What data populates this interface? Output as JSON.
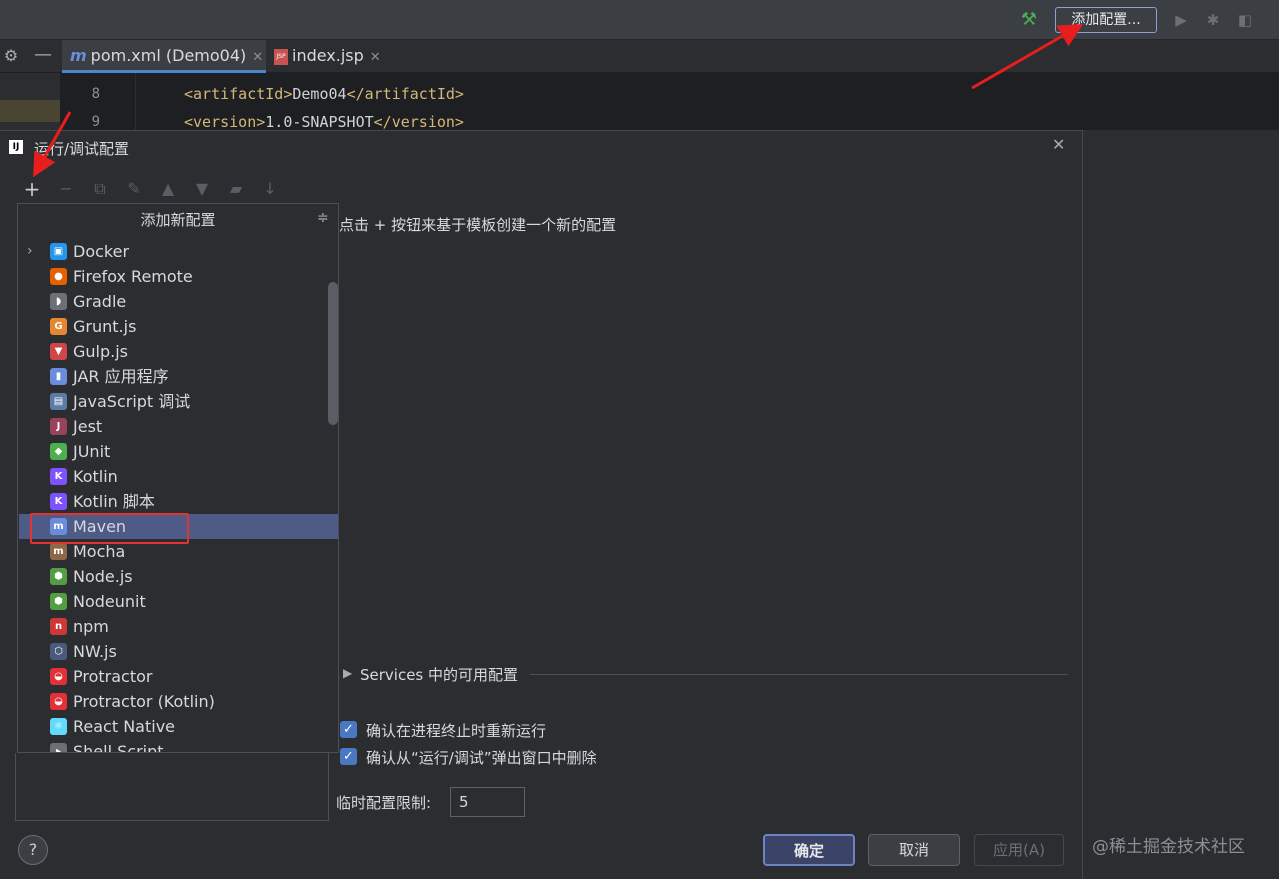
{
  "topbar": {
    "add_config_label": "添加配置...",
    "icons": [
      "hammer-icon",
      "run-icon",
      "debug-icon",
      "profile-icon"
    ]
  },
  "tabs": [
    {
      "label": "pom.xml (Demo04)",
      "icon": "maven-icon"
    },
    {
      "label": "index.jsp",
      "icon": "jsp-icon"
    }
  ],
  "editor": {
    "lines": [
      {
        "num": "8",
        "open": "<artifactId>",
        "text": "Demo04",
        "close": "</artifactId>"
      },
      {
        "num": "9",
        "open": "<version>",
        "text": "1.0-SNAPSHOT",
        "close": "</version>"
      }
    ]
  },
  "dialog": {
    "title": "运行/调试配置",
    "hint": "点击 + 按钮来基于模板创建一个新的配置",
    "popup_title": "添加新配置",
    "items": [
      {
        "label": "Docker",
        "icon": "docker-icon",
        "color": "#2496ed",
        "glyph": "▣",
        "expandable": true
      },
      {
        "label": "Firefox Remote",
        "icon": "firefox-icon",
        "color": "#e66000",
        "glyph": "●"
      },
      {
        "label": "Gradle",
        "icon": "gradle-icon",
        "color": "#6b6f76",
        "glyph": "◗"
      },
      {
        "label": "Grunt.js",
        "icon": "grunt-icon",
        "color": "#e48632",
        "glyph": "G"
      },
      {
        "label": "Gulp.js",
        "icon": "gulp-icon",
        "color": "#cf4647",
        "glyph": "▼"
      },
      {
        "label": "JAR 应用程序",
        "icon": "jar-icon",
        "color": "#6a8ddb",
        "glyph": "▮"
      },
      {
        "label": "JavaScript 调试",
        "icon": "js-debug-icon",
        "color": "#5c7ba8",
        "glyph": "▤"
      },
      {
        "label": "Jest",
        "icon": "jest-icon",
        "color": "#99425b",
        "glyph": "J"
      },
      {
        "label": "JUnit",
        "icon": "junit-icon",
        "color": "#4caf50",
        "glyph": "◆"
      },
      {
        "label": "Kotlin",
        "icon": "kotlin-icon",
        "color": "#7f52ff",
        "glyph": "K"
      },
      {
        "label": "Kotlin 脚本",
        "icon": "kotlin-script-icon",
        "color": "#7f52ff",
        "glyph": "K"
      },
      {
        "label": "Maven",
        "icon": "maven-icon",
        "color": "#6a8ddb",
        "glyph": "m",
        "selected": true
      },
      {
        "label": "Mocha",
        "icon": "mocha-icon",
        "color": "#8d6748",
        "glyph": "m"
      },
      {
        "label": "Node.js",
        "icon": "nodejs-icon",
        "color": "#539e43",
        "glyph": "⬢"
      },
      {
        "label": "Nodeunit",
        "icon": "nodeunit-icon",
        "color": "#539e43",
        "glyph": "⬢"
      },
      {
        "label": "npm",
        "icon": "npm-icon",
        "color": "#cb3837",
        "glyph": "n"
      },
      {
        "label": "NW.js",
        "icon": "nwjs-icon",
        "color": "#4a5a7a",
        "glyph": "⬡"
      },
      {
        "label": "Protractor",
        "icon": "protractor-icon",
        "color": "#e23237",
        "glyph": "◒"
      },
      {
        "label": "Protractor (Kotlin)",
        "icon": "protractor-kotlin-icon",
        "color": "#e23237",
        "glyph": "◒"
      },
      {
        "label": "React Native",
        "icon": "react-icon",
        "color": "#61dafb",
        "glyph": "⚛"
      },
      {
        "label": "Shell Script",
        "icon": "shell-icon",
        "color": "#6b6f76",
        "glyph": "▸"
      }
    ],
    "services_label": "Services 中的可用配置",
    "checkbox1_label": "确认在进程终止时重新运行",
    "checkbox2_label": "确认从“运行/调试”弹出窗口中删除",
    "temp_limit_label": "临时配置限制:",
    "temp_limit_value": "5",
    "ok_label": "确定",
    "cancel_label": "取消",
    "apply_label": "应用(A)"
  },
  "watermark": "@稀土掘金技术社区"
}
